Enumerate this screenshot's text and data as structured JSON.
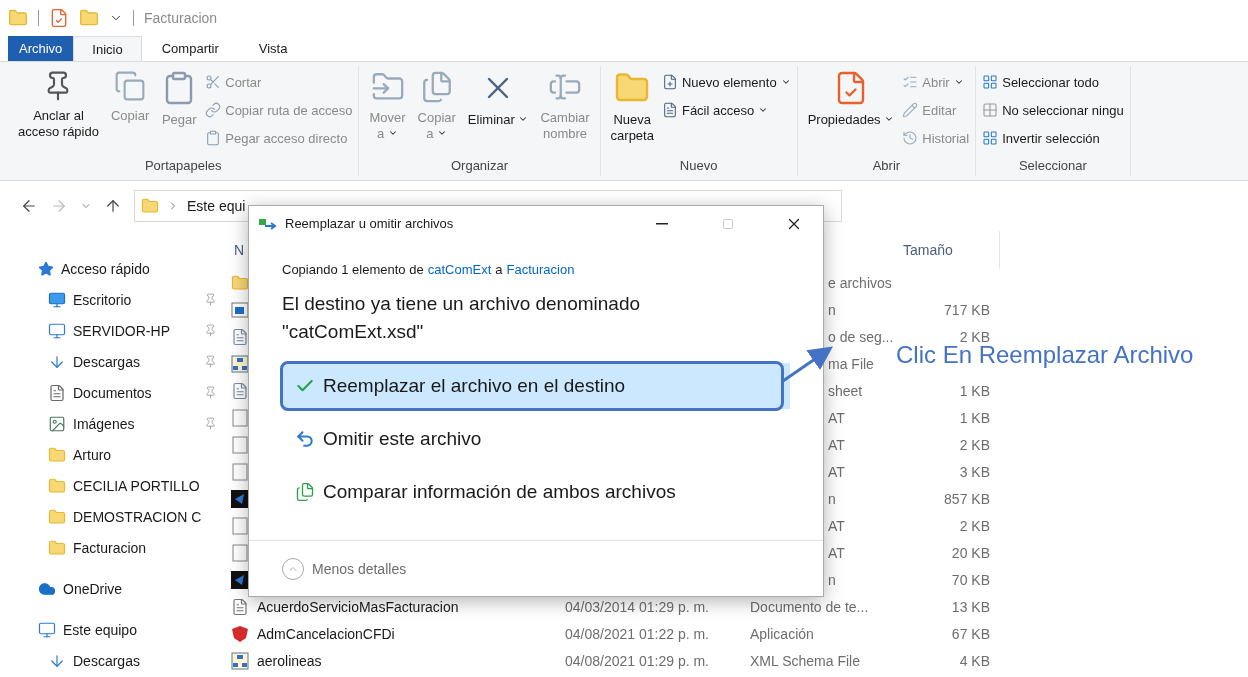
{
  "window": {
    "title": "Facturacion"
  },
  "tabs": [
    {
      "label": "Archivo",
      "kind": "file",
      "selected": false
    },
    {
      "label": "Inicio",
      "kind": "tab",
      "selected": true
    },
    {
      "label": "Compartir",
      "kind": "tab",
      "selected": false
    },
    {
      "label": "Vista",
      "kind": "tab",
      "selected": false
    }
  ],
  "ribbon": {
    "groups": [
      {
        "label": "Portapapeles",
        "large": [
          {
            "label": "Anclar al\nacceso rápido",
            "disabled": false,
            "dropdown": false
          },
          {
            "label": "Copiar",
            "disabled": true,
            "dropdown": false
          },
          {
            "label": "Pegar",
            "disabled": true,
            "dropdown": false
          }
        ],
        "small": [
          {
            "label": "Cortar",
            "disabled": true,
            "dropdown": false
          },
          {
            "label": "Copiar ruta de acceso",
            "disabled": true,
            "dropdown": false
          },
          {
            "label": "Pegar acceso directo",
            "disabled": true,
            "dropdown": false
          }
        ]
      },
      {
        "label": "Organizar",
        "large": [
          {
            "label": "Mover\na",
            "disabled": true,
            "dropdown": true
          },
          {
            "label": "Copiar\na",
            "disabled": true,
            "dropdown": true
          },
          {
            "label": "Eliminar",
            "disabled": false,
            "dropdown": true
          },
          {
            "label": "Cambiar\nnombre",
            "disabled": true,
            "dropdown": false
          }
        ]
      },
      {
        "label": "Nuevo",
        "large": [
          {
            "label": "Nueva\ncarpeta",
            "disabled": false,
            "dropdown": false
          }
        ],
        "small": [
          {
            "label": "Nuevo elemento",
            "disabled": false,
            "dropdown": true
          },
          {
            "label": "Fácil acceso",
            "disabled": false,
            "dropdown": true
          }
        ]
      },
      {
        "label": "Abrir",
        "large": [
          {
            "label": "Propiedades",
            "disabled": false,
            "dropdown": true
          }
        ],
        "small": [
          {
            "label": "Abrir",
            "disabled": true,
            "dropdown": true
          },
          {
            "label": "Editar",
            "disabled": true,
            "dropdown": false
          },
          {
            "label": "Historial",
            "disabled": true,
            "dropdown": false
          }
        ]
      },
      {
        "label": "Seleccionar",
        "small": [
          {
            "label": "Seleccionar todo",
            "disabled": false,
            "dropdown": false
          },
          {
            "label": "No seleccionar ningu",
            "disabled": false,
            "dropdown": false
          },
          {
            "label": "Invertir selección",
            "disabled": false,
            "dropdown": false
          }
        ]
      }
    ]
  },
  "address": {
    "path": "Este equi"
  },
  "sidebar": {
    "items": [
      {
        "label": "Acceso rápido",
        "children": [
          {
            "label": "Escritorio",
            "pinned": true
          },
          {
            "label": "SERVIDOR-HP",
            "pinned": true
          },
          {
            "label": "Descargas",
            "pinned": true
          },
          {
            "label": "Documentos",
            "pinned": true
          },
          {
            "label": "Imágenes",
            "pinned": true
          },
          {
            "label": "Arturo",
            "pinned": false
          },
          {
            "label": "CECILIA PORTILLO",
            "pinned": false
          },
          {
            "label": "DEMOSTRACION C",
            "pinned": false
          },
          {
            "label": "Facturacion",
            "pinned": false
          }
        ]
      },
      {
        "label": "OneDrive"
      },
      {
        "label": "Este equipo",
        "children": [
          {
            "label": "Descargas",
            "pinned": false
          }
        ]
      }
    ]
  },
  "file_list": {
    "columns": [
      "N",
      "Tamaño"
    ],
    "rows": [
      {
        "kind": "covered",
        "type": "e archivos"
      },
      {
        "kind": "covered",
        "type": "n",
        "size": "717 KB"
      },
      {
        "kind": "covered",
        "type": "o de seg...",
        "size": "2 KB"
      },
      {
        "kind": "covered",
        "type": "ma File"
      },
      {
        "kind": "covered",
        "type": "sheet",
        "size": "1 KB"
      },
      {
        "kind": "covered",
        "type": "AT",
        "size": "1 KB"
      },
      {
        "kind": "covered",
        "type": "AT",
        "size": "2 KB"
      },
      {
        "kind": "covered",
        "type": "AT",
        "size": "3 KB"
      },
      {
        "kind": "covered",
        "type": "n",
        "size": "857 KB"
      },
      {
        "kind": "covered",
        "type": "AT",
        "size": "2 KB"
      },
      {
        "kind": "covered",
        "type": "AT",
        "size": "20 KB"
      },
      {
        "kind": "covered",
        "type": "n",
        "size": "70 KB"
      },
      {
        "kind": "file",
        "name": "AcuerdoServicioMasFacturacion",
        "date": "04/03/2014 01:29 p. m.",
        "type": "Documento de te...",
        "size": "13 KB"
      },
      {
        "kind": "file",
        "name": "AdmCancelacionCFDi",
        "date": "04/08/2021 01:22 p. m.",
        "type": "Aplicación",
        "size": "67 KB"
      },
      {
        "kind": "file",
        "name": "aerolineas",
        "date": "04/08/2021 01:29 p. m.",
        "type": "XML Schema File",
        "size": "4 KB"
      }
    ]
  },
  "dialog": {
    "title": "Reemplazar u omitir archivos",
    "copy_prefix": "Copiando 1 elemento de",
    "source": "catComExt",
    "connector": "a",
    "destination": "Facturacion",
    "message_lines": [
      "El destino ya tiene un archivo denominado",
      "\"catComExt.xsd\""
    ],
    "options": [
      {
        "label": "Reemplazar el archivo en el destino",
        "selected": true
      },
      {
        "label": "Omitir este archivo",
        "selected": false
      },
      {
        "label": "Comparar información de ambos archivos",
        "selected": false
      }
    ],
    "details_toggle": "Menos detalles"
  },
  "annotation": {
    "text": "Clic En Reemplazar Archivo"
  }
}
